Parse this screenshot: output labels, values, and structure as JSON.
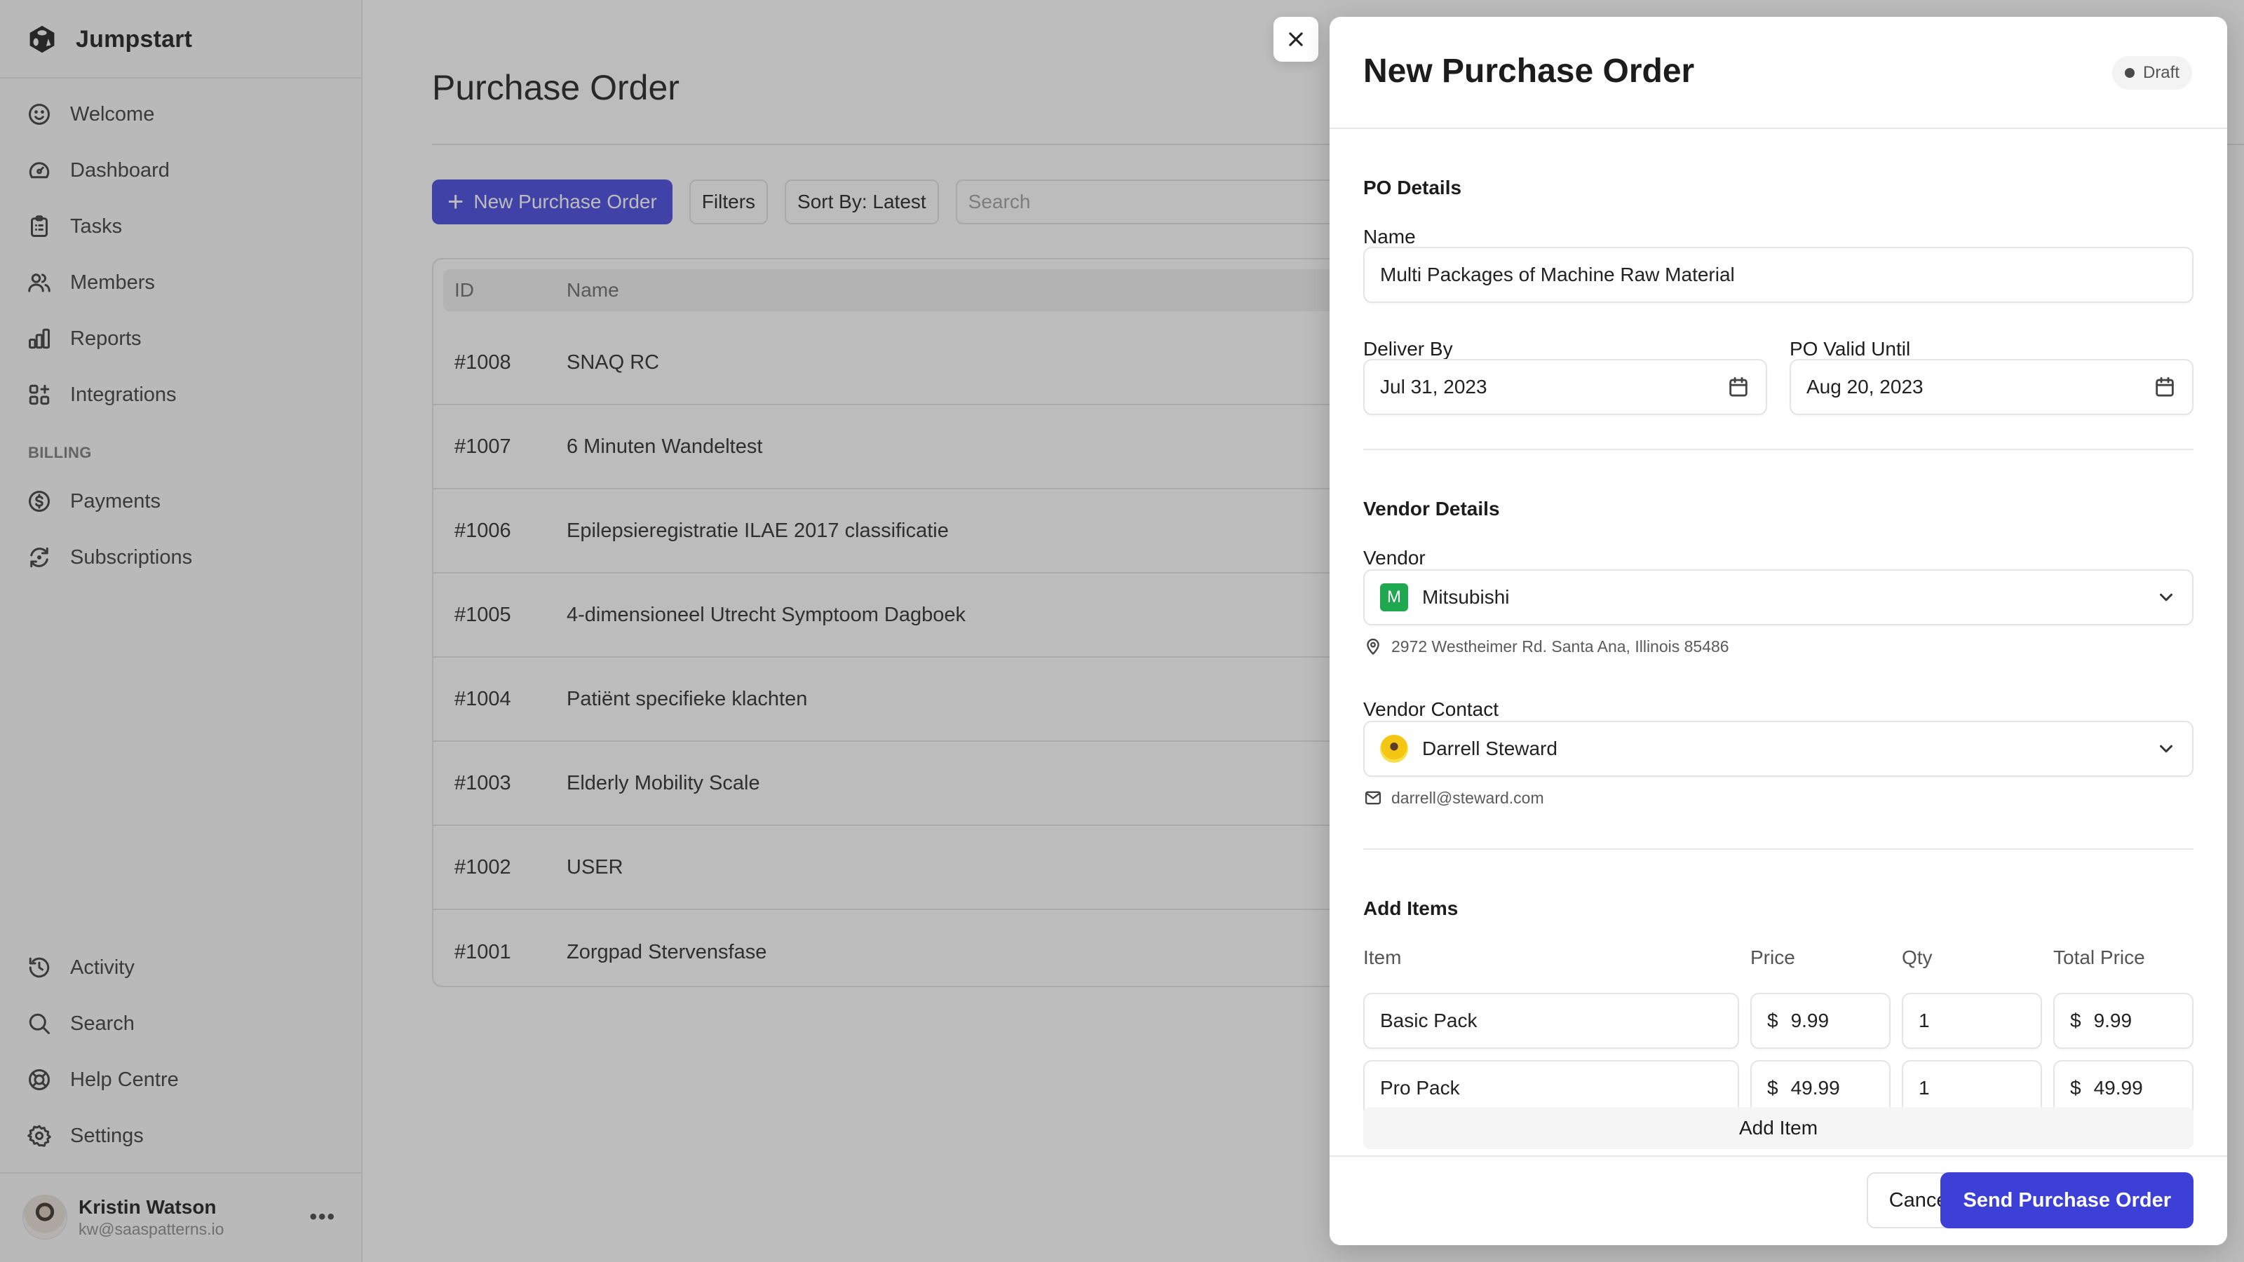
{
  "app": {
    "brand": "Jumpstart",
    "brand_icon": "cube-logo-icon"
  },
  "sidebar": {
    "items": [
      {
        "label": "Welcome",
        "icon": "smile-icon"
      },
      {
        "label": "Dashboard",
        "icon": "gauge-icon"
      },
      {
        "label": "Tasks",
        "icon": "clipboard-icon"
      },
      {
        "label": "Members",
        "icon": "users-icon"
      },
      {
        "label": "Reports",
        "icon": "bar-chart-icon"
      },
      {
        "label": "Integrations",
        "icon": "apps-plus-icon"
      }
    ],
    "billing_section": "BILLING",
    "billing_items": [
      {
        "label": "Payments",
        "icon": "dollar-circle-icon"
      },
      {
        "label": "Subscriptions",
        "icon": "refresh-icon"
      }
    ],
    "bottom_items": [
      {
        "label": "Activity",
        "icon": "history-icon"
      },
      {
        "label": "Search",
        "icon": "search-icon"
      },
      {
        "label": "Help Centre",
        "icon": "lifebuoy-icon"
      },
      {
        "label": "Settings",
        "icon": "gear-icon"
      }
    ],
    "user": {
      "name": "Kristin Watson",
      "email": "kw@saaspatterns.io",
      "menu_icon": "more-horizontal-icon"
    }
  },
  "main": {
    "title": "Purchase Order",
    "toolbar": {
      "new_label": "New Purchase Order",
      "filters_label": "Filters",
      "sort_label": "Sort By: Latest",
      "search_placeholder": "Search"
    },
    "table": {
      "columns": [
        "ID",
        "Name"
      ],
      "rows": [
        {
          "id": "#1008",
          "name": "SNAQ RC"
        },
        {
          "id": "#1007",
          "name": "6 Minuten Wandeltest"
        },
        {
          "id": "#1006",
          "name": "Epilepsieregistratie ILAE 2017 classificatie"
        },
        {
          "id": "#1005",
          "name": "4-dimensioneel Utrecht Symptoom Dagboek"
        },
        {
          "id": "#1004",
          "name": "Patiënt specifieke klachten"
        },
        {
          "id": "#1003",
          "name": "Elderly Mobility Scale"
        },
        {
          "id": "#1002",
          "name": "USER"
        },
        {
          "id": "#1001",
          "name": "Zorgpad Stervensfase"
        }
      ]
    }
  },
  "drawer": {
    "title": "New Purchase Order",
    "status": "Draft",
    "po_details": {
      "section": "PO Details",
      "name_label": "Name",
      "name_value": "Multi Packages of Machine Raw Material",
      "deliver_label": "Deliver By",
      "deliver_value": "Jul 31, 2023",
      "valid_label": "PO Valid Until",
      "valid_value": "Aug 20, 2023"
    },
    "vendor_details": {
      "section": "Vendor Details",
      "vendor_label": "Vendor",
      "vendor_value": "Mitsubishi",
      "vendor_initial": "M",
      "vendor_color": "#1fa84f",
      "address": "2972 Westheimer Rd. Santa Ana, Illinois 85486",
      "contact_label": "Vendor Contact",
      "contact_value": "Darrell Steward",
      "contact_email": "darrell@steward.com"
    },
    "items": {
      "section": "Add Items",
      "columns": [
        "Item",
        "Price",
        "Qty",
        "Total Price"
      ],
      "currency": "$",
      "rows": [
        {
          "item": "Basic Pack",
          "price": "9.99",
          "qty": "1",
          "total": "9.99"
        },
        {
          "item": "Pro Pack",
          "price": "49.99",
          "qty": "1",
          "total": "49.99"
        }
      ],
      "add_label": "Add Item"
    },
    "footer": {
      "cancel_label": "Cancel",
      "send_label": "Send Purchase Order"
    }
  },
  "colors": {
    "primary": "#3d40d6",
    "vendor_badge": "#1fa84f",
    "overlay": "rgba(60,60,60,0.34)"
  }
}
